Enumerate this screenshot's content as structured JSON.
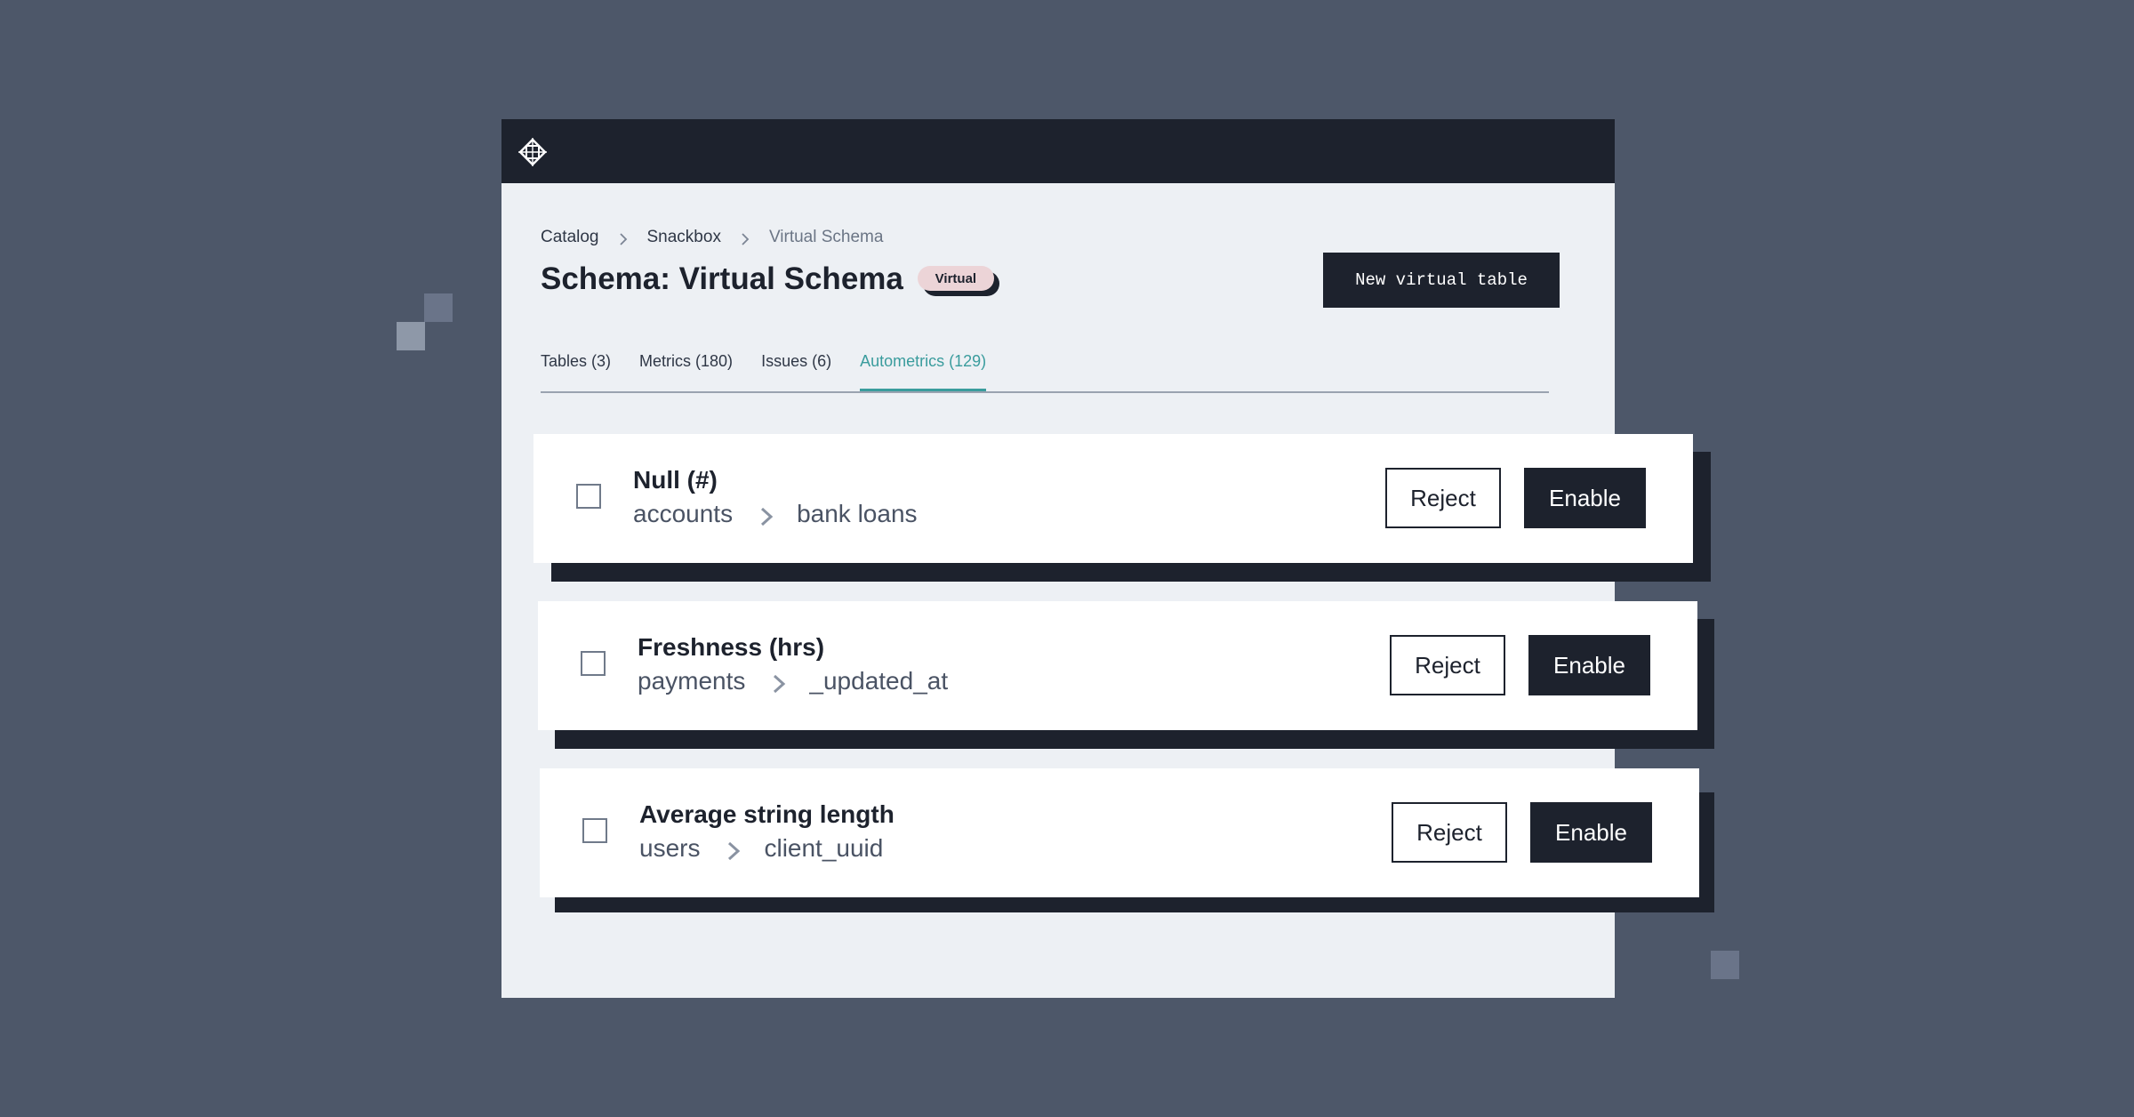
{
  "colors": {
    "background": "#4d5769",
    "topbar": "#1d222d",
    "accent": "#3a9c9d",
    "badge": "#ecd4d7",
    "panel": "#edf0f4"
  },
  "header": {
    "logo_icon": "diamond-crosshair-icon"
  },
  "breadcrumb": {
    "items": [
      "Catalog",
      "Snackbox",
      "Virtual Schema"
    ],
    "separator_icon": "chevron-right-icon"
  },
  "page": {
    "title": "Schema: Virtual Schema",
    "badge": "Virtual",
    "new_button": "New virtual table"
  },
  "tabs": [
    {
      "label": "Tables (3)",
      "active": false
    },
    {
      "label": "Metrics (180)",
      "active": false
    },
    {
      "label": "Issues (6)",
      "active": false
    },
    {
      "label": "Autometrics (129)",
      "active": true
    }
  ],
  "autometrics": [
    {
      "name": "Null (#)",
      "table": "accounts",
      "column": "bank loans",
      "checked": false,
      "reject_label": "Reject",
      "enable_label": "Enable"
    },
    {
      "name": "Freshness (hrs)",
      "table": "payments",
      "column": "_updated_at",
      "checked": false,
      "reject_label": "Reject",
      "enable_label": "Enable"
    },
    {
      "name": "Average string length",
      "table": "users",
      "column": "client_uuid",
      "checked": false,
      "reject_label": "Reject",
      "enable_label": "Enable"
    }
  ]
}
